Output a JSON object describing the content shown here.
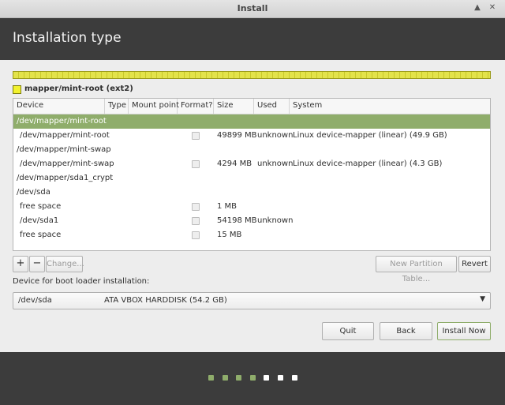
{
  "window": {
    "title": "Install",
    "controls": [
      "chevron-up-icon",
      "close-icon"
    ]
  },
  "header": {
    "title": "Installation type"
  },
  "partition_bar": {
    "color": "#e3e34a",
    "legend_label": "mapper/mint-root (ext2)"
  },
  "table": {
    "columns": [
      "Device",
      "Type",
      "Mount point",
      "Format?",
      "Size",
      "Used",
      "System"
    ],
    "rows": [
      {
        "device": "/dev/mapper/mint-root",
        "type": "",
        "mount": "",
        "format": false,
        "size": "",
        "used": "",
        "system": "",
        "selected": true,
        "has_format": false
      },
      {
        "device": "/dev/mapper/mint-root",
        "type": "",
        "mount": "",
        "format": false,
        "size": "49899 MB",
        "used": "unknown",
        "system": "Linux device-mapper (linear) (49.9 GB)",
        "selected": false,
        "has_format": true
      },
      {
        "device": "/dev/mapper/mint-swap",
        "type": "",
        "mount": "",
        "format": false,
        "size": "",
        "used": "",
        "system": "",
        "selected": false,
        "has_format": false
      },
      {
        "device": "/dev/mapper/mint-swap",
        "type": "",
        "mount": "",
        "format": false,
        "size": "4294 MB",
        "used": "unknown",
        "system": "Linux device-mapper (linear) (4.3 GB)",
        "selected": false,
        "has_format": true
      },
      {
        "device": "/dev/mapper/sda1_crypt",
        "type": "",
        "mount": "",
        "format": false,
        "size": "",
        "used": "",
        "system": "",
        "selected": false,
        "has_format": false
      },
      {
        "device": "/dev/sda",
        "type": "",
        "mount": "",
        "format": false,
        "size": "",
        "used": "",
        "system": "",
        "selected": false,
        "has_format": false
      },
      {
        "device": "free space",
        "type": "",
        "mount": "",
        "format": false,
        "size": "1 MB",
        "used": "",
        "system": "",
        "selected": false,
        "has_format": true
      },
      {
        "device": "/dev/sda1",
        "type": "",
        "mount": "",
        "format": false,
        "size": "54198 MB",
        "used": "unknown",
        "system": "",
        "selected": false,
        "has_format": true
      },
      {
        "device": "free space",
        "type": "",
        "mount": "",
        "format": false,
        "size": "15 MB",
        "used": "",
        "system": "",
        "selected": false,
        "has_format": true
      }
    ]
  },
  "toolbar": {
    "add_label": "+",
    "remove_label": "−",
    "change_label": "Change...",
    "new_table_label": "New Partition Table...",
    "revert_label": "Revert"
  },
  "bootloader": {
    "label": "Device for boot loader installation:",
    "device": "/dev/sda",
    "description": "ATA VBOX HARDDISK (54.2 GB)"
  },
  "buttons": {
    "quit": "Quit",
    "back": "Back",
    "install": "Install Now"
  },
  "progress": {
    "steps_total": 7,
    "steps_done": 4,
    "done_color": "#8fad6b",
    "todo_color": "#ffffff"
  }
}
